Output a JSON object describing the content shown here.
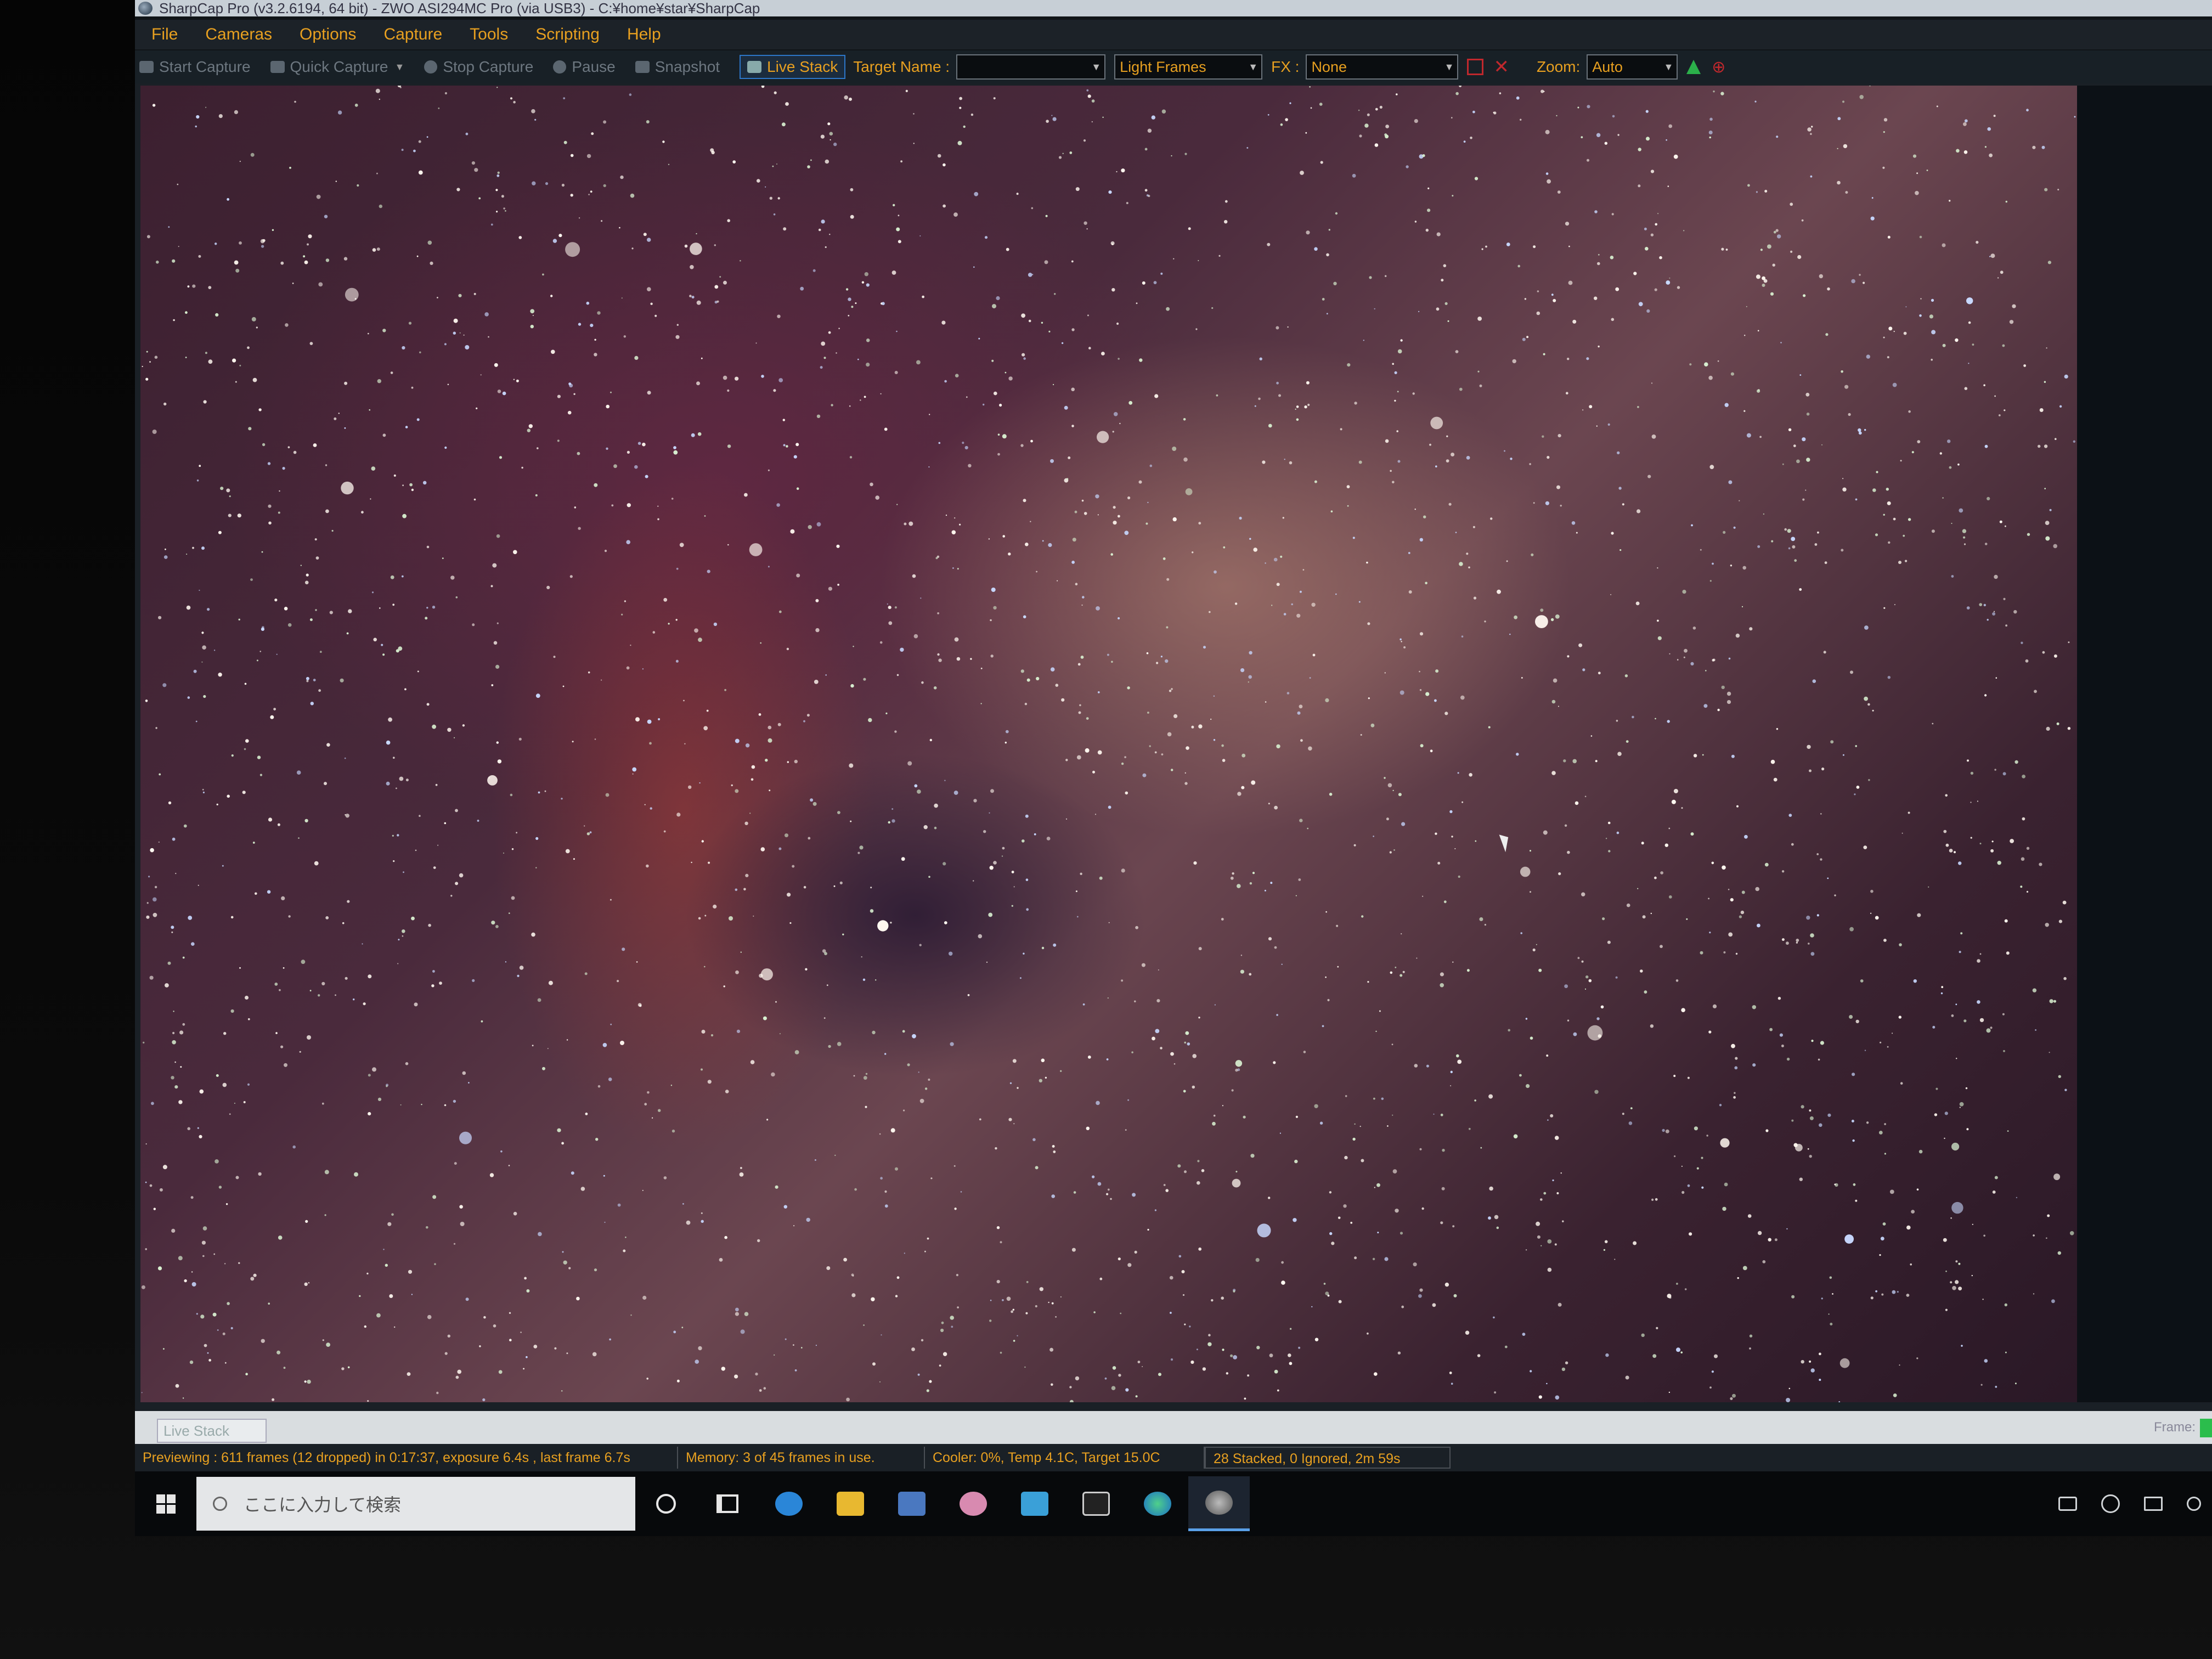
{
  "window": {
    "title": "SharpCap Pro (v3.2.6194, 64 bit) - ZWO ASI294MC Pro (via USB3) - C:¥home¥star¥SharpCap"
  },
  "menu": {
    "items": [
      "File",
      "Cameras",
      "Options",
      "Capture",
      "Tools",
      "Scripting",
      "Help"
    ]
  },
  "toolbar": {
    "start_capture": "Start Capture",
    "quick_capture": "Quick Capture",
    "stop_capture": "Stop Capture",
    "pause": "Pause",
    "snapshot": "Snapshot",
    "live_stack": "Live Stack",
    "target_name_label": "Target Name :",
    "target_name_value": "",
    "frame_type": "Light Frames",
    "fx_label": "FX :",
    "fx_value": "None",
    "zoom_label": "Zoom:",
    "zoom_value": "Auto"
  },
  "live_stack_tab": {
    "label": "Live Stack"
  },
  "frame_label": "Frame:",
  "status": {
    "preview": "Previewing : 611 frames (12 dropped) in 0:17:37, exposure 6.4s , last frame 6.7s",
    "memory": "Memory: 3 of 45 frames in use.",
    "cooler": "Cooler: 0%, Temp 4.1C, Target 15.0C",
    "stacked": "28 Stacked, 0 Ignored, 2m 59s"
  },
  "taskbar": {
    "search_placeholder": "ここに入力して検索",
    "apps": [
      "cortana-icon",
      "task-view-icon",
      "ie-icon",
      "file-explorer-icon",
      "network-icon",
      "paint-icon",
      "mail-icon",
      "terminal-icon",
      "edge-icon",
      "sharpcap-icon"
    ]
  },
  "colors": {
    "accent": "#e8a020",
    "menu_bg": "#1c2228",
    "live_stack_border": "#2c76c8"
  }
}
